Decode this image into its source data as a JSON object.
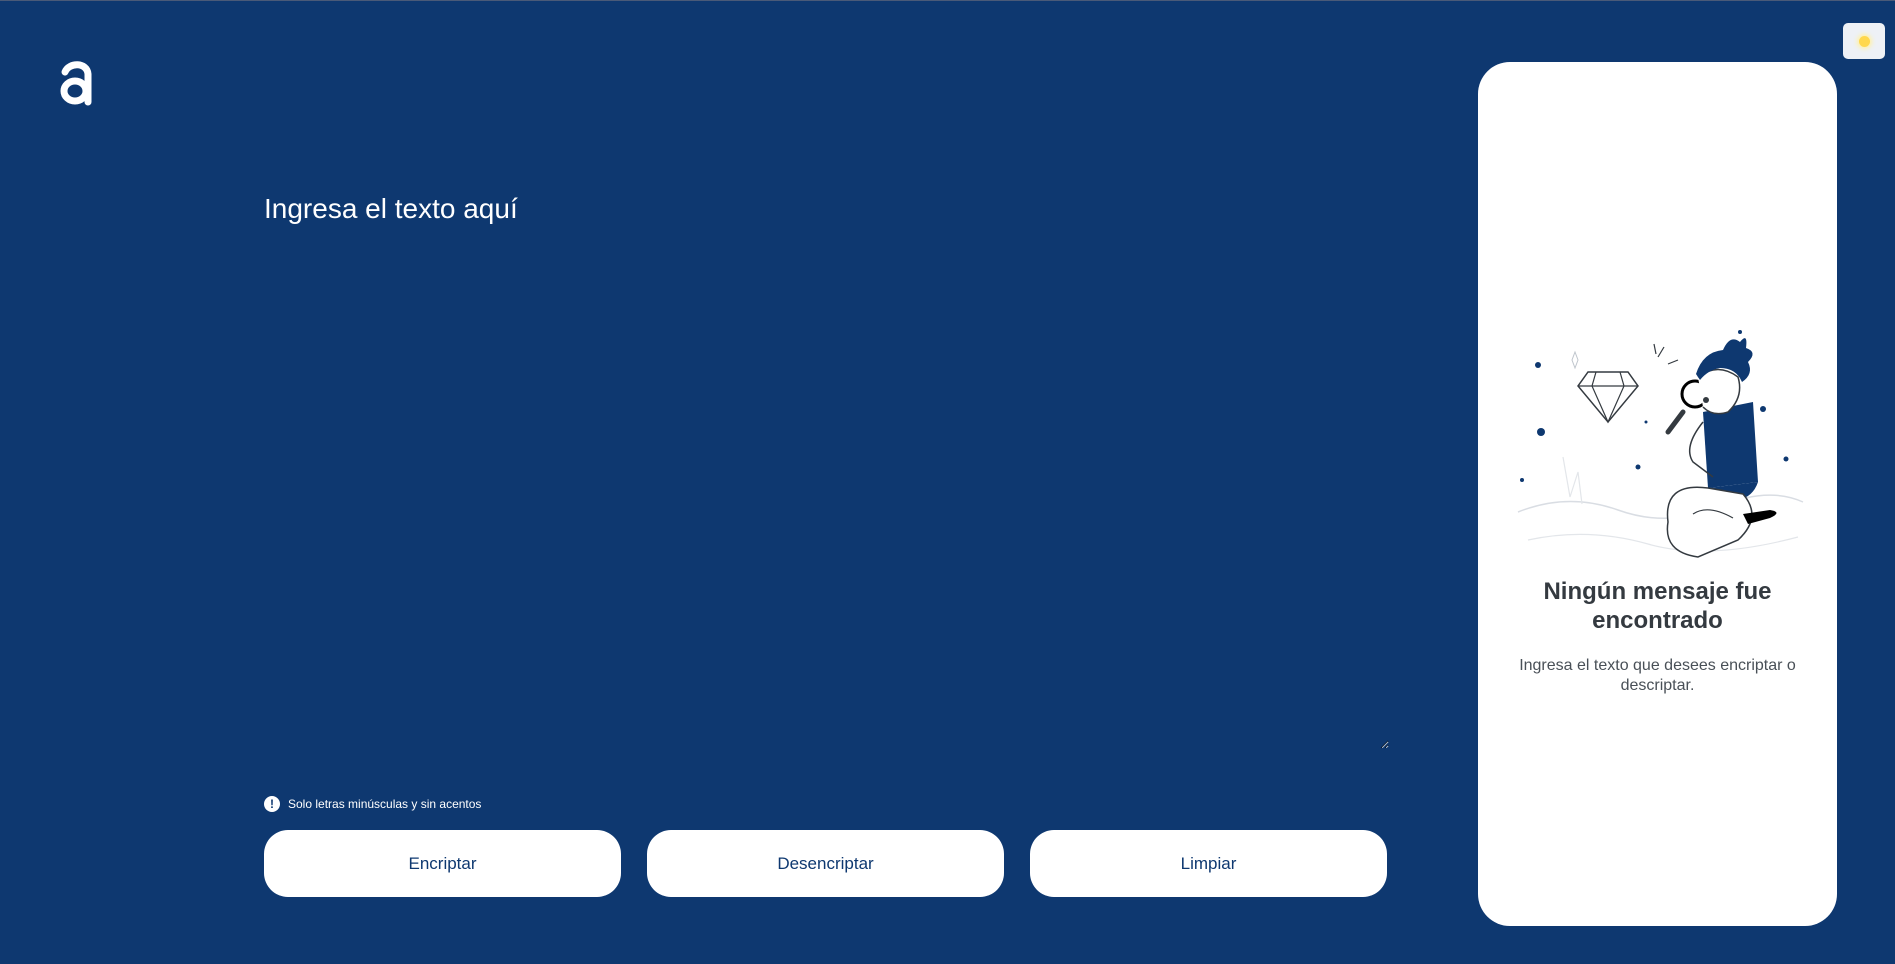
{
  "header": {
    "logo_icon": "alura-a-logo-icon",
    "theme_toggle_icon": "sun-icon"
  },
  "editor": {
    "placeholder": "Ingresa el texto aquí",
    "value": ""
  },
  "hint": {
    "icon": "exclamation-circle-icon",
    "text": "Solo letras minúsculas y sin acentos"
  },
  "buttons": {
    "encrypt_label": "Encriptar",
    "decrypt_label": "Desencriptar",
    "clear_label": "Limpiar"
  },
  "output_panel": {
    "illustration_icon": "person-with-magnifying-glass-illustration",
    "title": "Ningún mensaje fue encontrado",
    "subtitle": "Ingresa el texto que desees encriptar o descriptar."
  },
  "colors": {
    "background": "#0E3870",
    "panel": "#FFFFFF",
    "button_text": "#0E3870",
    "sun": "#FFD84D"
  }
}
